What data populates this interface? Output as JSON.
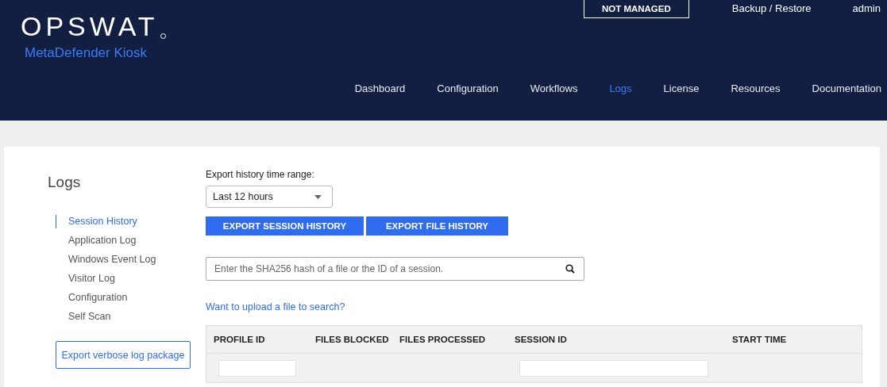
{
  "header": {
    "logo": "OPSWAT",
    "product": "MetaDefender Kiosk",
    "status_badge": "NOT MANAGED",
    "top_links": [
      "Backup / Restore",
      "admin"
    ],
    "nav": [
      {
        "label": "Dashboard",
        "selected": false
      },
      {
        "label": "Configuration",
        "selected": false
      },
      {
        "label": "Workflows",
        "selected": false
      },
      {
        "label": "Logs",
        "selected": true
      },
      {
        "label": "License",
        "selected": false
      },
      {
        "label": "Resources",
        "selected": false
      },
      {
        "label": "Documentation",
        "selected": false
      }
    ]
  },
  "sidebar": {
    "title": "Logs",
    "items": [
      {
        "label": "Session History",
        "selected": true
      },
      {
        "label": "Application Log",
        "selected": false
      },
      {
        "label": "Windows Event Log",
        "selected": false
      },
      {
        "label": "Visitor Log",
        "selected": false
      },
      {
        "label": "Configuration",
        "selected": false
      },
      {
        "label": "Self Scan",
        "selected": false
      }
    ],
    "export_button": "Export verbose log package"
  },
  "main": {
    "range_label": "Export history time range:",
    "range_value": "Last 12 hours",
    "buttons": [
      "EXPORT SESSION HISTORY",
      "EXPORT FILE HISTORY"
    ],
    "search": {
      "placeholder": "Enter the SHA256 hash of a file or the ID of a session."
    },
    "upload_link": "Want to upload a file to search?",
    "table": {
      "columns": [
        {
          "label": "PROFILE ID",
          "filter": true
        },
        {
          "label": "FILES BLOCKED",
          "filter": false
        },
        {
          "label": "FILES PROCESSED",
          "filter": false
        },
        {
          "label": "SESSION ID",
          "filter": true
        },
        {
          "label": "START TIME",
          "filter": false
        }
      ]
    }
  }
}
